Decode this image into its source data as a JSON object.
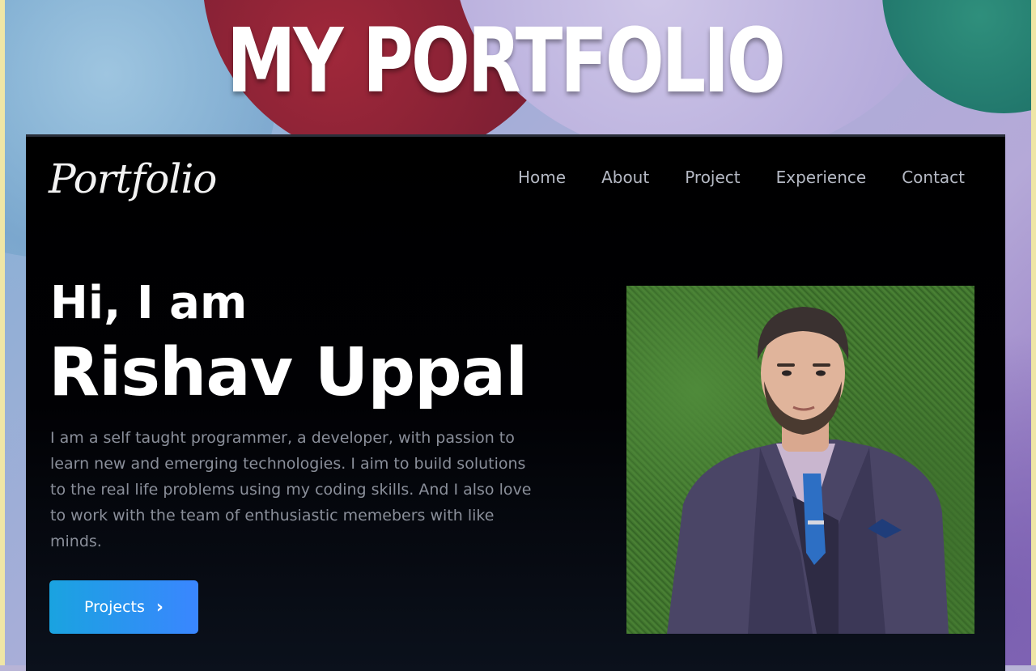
{
  "banner": {
    "title": "MY PORTFOLIO"
  },
  "site": {
    "logo": "Portfolio",
    "nav": [
      "Home",
      "About",
      "Project",
      "Experience",
      "Contact"
    ],
    "hero": {
      "greeting": "Hi, I am",
      "name": "Rishav Uppal",
      "bio": "I am a self taught programmer, a developer, with passion to learn new and emerging technologies. I aim to build solutions to the real life problems using my coding skills. And I also love to work with the team of enthusiastic memebers with like minds.",
      "button_label": "Projects",
      "button_icon": "chevron-right-icon"
    },
    "colors": {
      "background": "#000000",
      "nav_text": "#b5b9c4",
      "bio_text": "#8a8f9a",
      "button_gradient_start": "#1aa3e0",
      "button_gradient_end": "#3a86ff"
    }
  }
}
